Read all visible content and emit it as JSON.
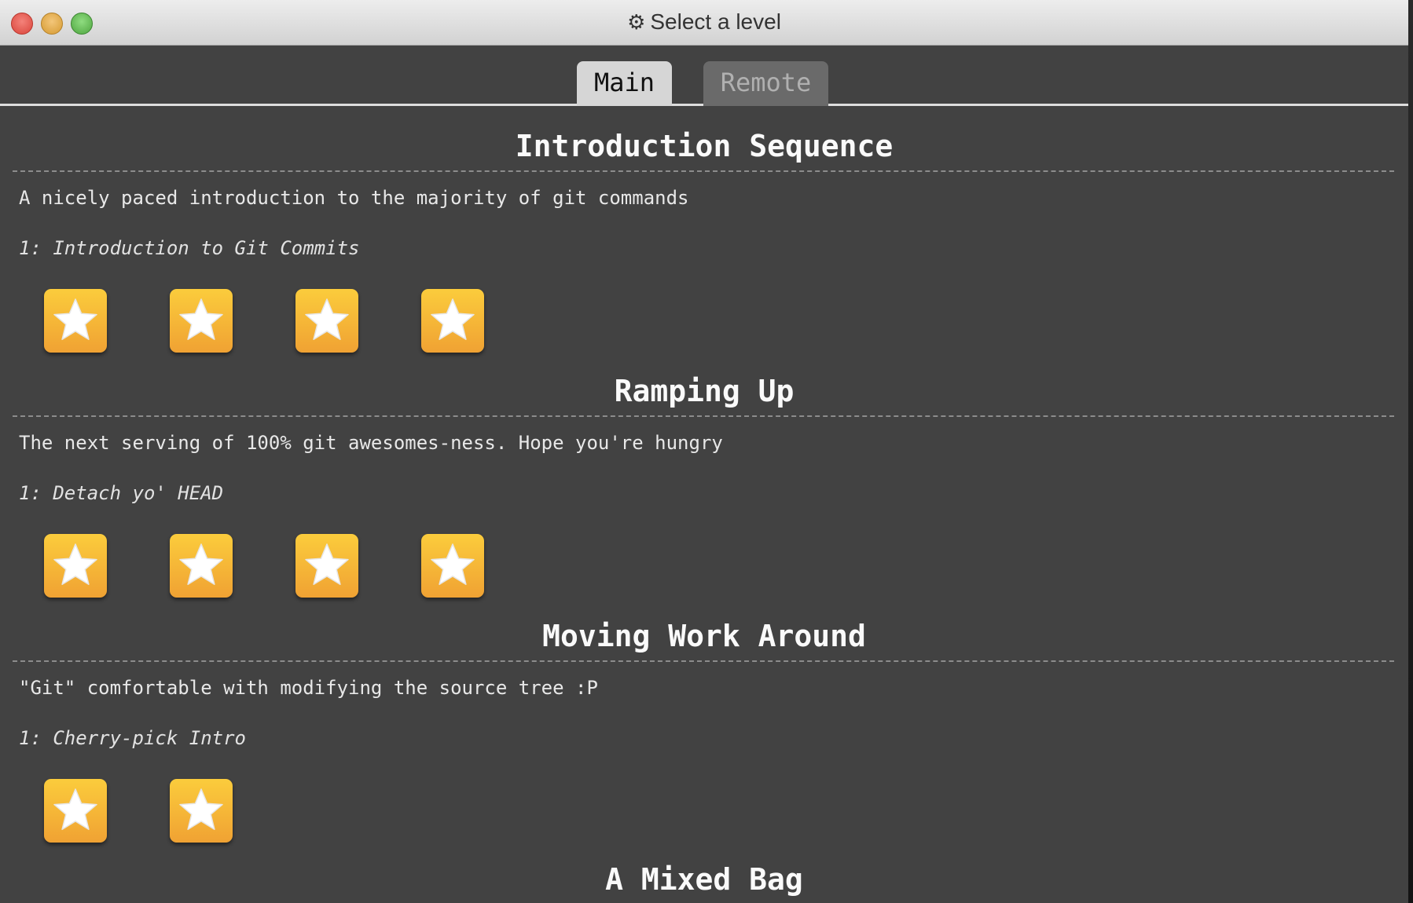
{
  "window": {
    "title": "Select a level",
    "title_icon": "gear-icon"
  },
  "tabs": [
    {
      "label": "Main",
      "active": true
    },
    {
      "label": "Remote",
      "active": false
    }
  ],
  "sections": [
    {
      "title": "Introduction Sequence",
      "description": "A nicely paced introduction to the majority of git commands",
      "level_label": "1: Introduction to Git Commits",
      "level_buttons": 4
    },
    {
      "title": "Ramping Up",
      "description": "The next serving of 100% git awesomes-ness. Hope you're hungry",
      "level_label": "1: Detach yo' HEAD",
      "level_buttons": 4
    },
    {
      "title": "Moving Work Around",
      "description": "\"Git\" comfortable with modifying the source tree :P",
      "level_label": "1: Cherry-pick Intro",
      "level_buttons": 2
    },
    {
      "title": "A Mixed Bag"
    }
  ],
  "colors": {
    "background": "#424242",
    "star_button": "#f5b536",
    "tab_active": "#d6d6d6",
    "tab_inactive": "#6a6a6a"
  }
}
